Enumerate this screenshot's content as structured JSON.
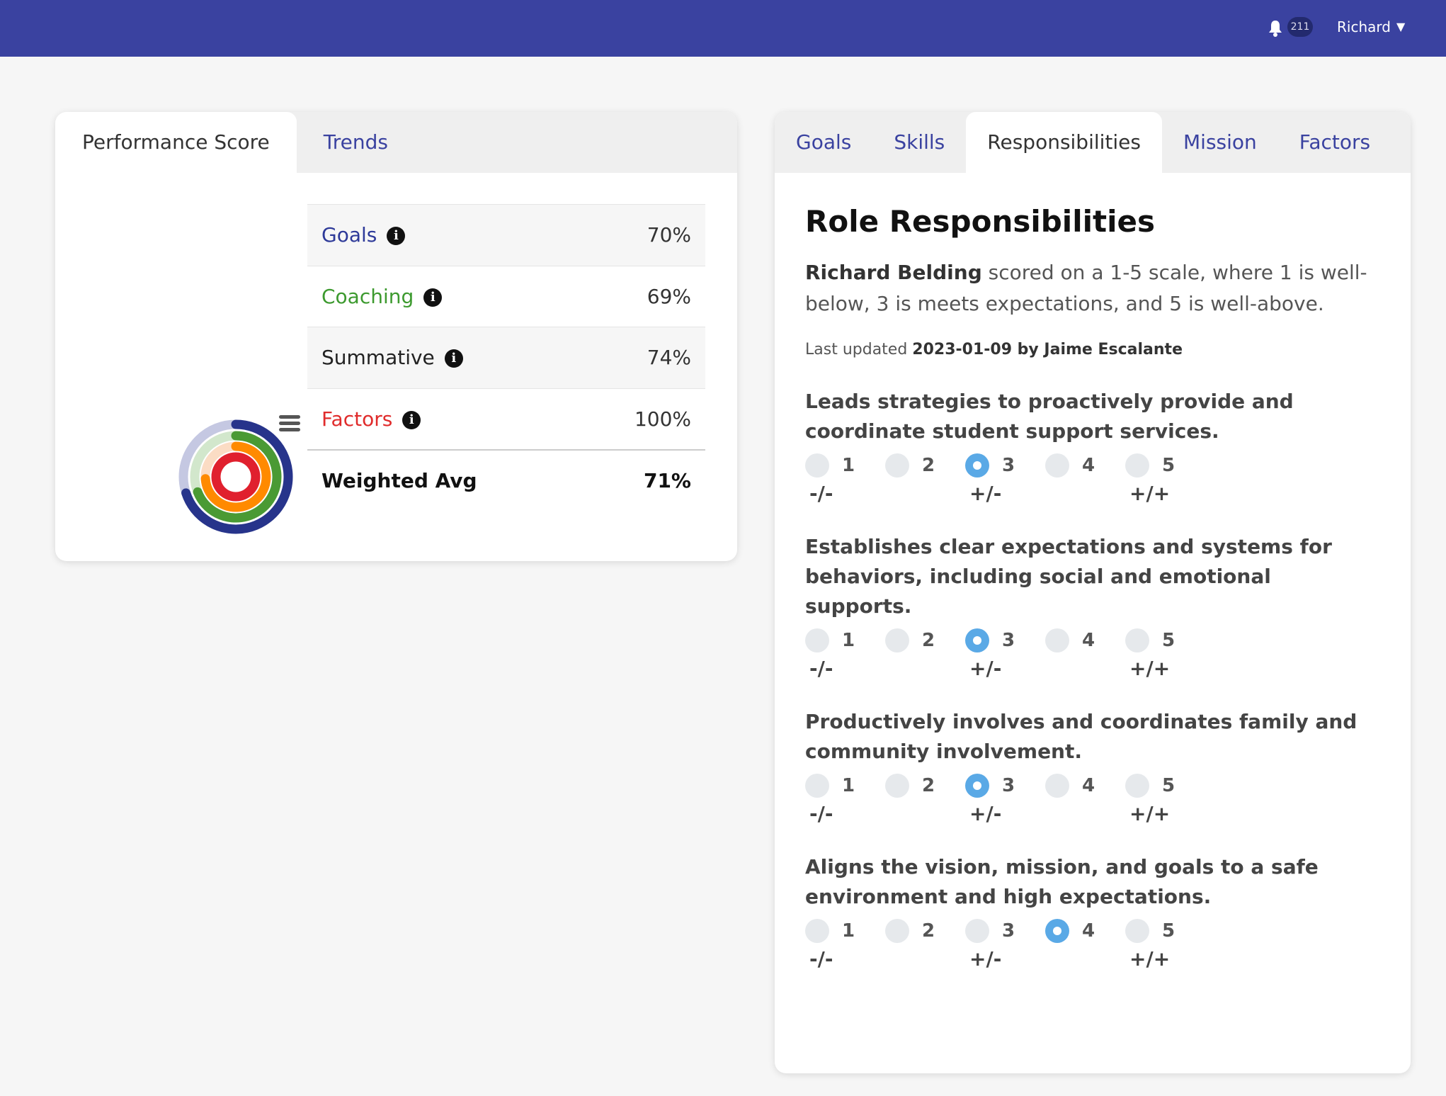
{
  "header": {
    "notification_count": "211",
    "user_name": "Richard",
    "icons": [
      "bell-icon",
      "chevron-down-icon"
    ],
    "color": "#3a42a0"
  },
  "left_panel": {
    "tabs": [
      {
        "label": "Performance Score",
        "active": true
      },
      {
        "label": "Trends",
        "active": false
      }
    ],
    "rows": [
      {
        "label": "Goals",
        "value": "70%",
        "color": "#2e3a99"
      },
      {
        "label": "Coaching",
        "value": "69%",
        "color": "#3d9a2f"
      },
      {
        "label": "Summative",
        "value": "74%",
        "color": "#222222"
      },
      {
        "label": "Factors",
        "value": "100%",
        "color": "#e02b2b"
      }
    ],
    "total": {
      "label": "Weighted Avg",
      "value": "71%"
    }
  },
  "chart_data": {
    "type": "radial-bar",
    "series": [
      {
        "name": "Goals",
        "value": 70,
        "color": "#27348b",
        "track": "#c5c8e2"
      },
      {
        "name": "Coaching",
        "value": 69,
        "color": "#4a9a34",
        "track": "#d2e7cc"
      },
      {
        "name": "Summative",
        "value": 74,
        "color": "#ff8a00",
        "track": "#fbdcc4"
      },
      {
        "name": "Factors",
        "value": 100,
        "color": "#e0202e",
        "track": "#f7c6c9"
      }
    ],
    "max": 100
  },
  "right_panel": {
    "tabs": [
      {
        "label": "Goals",
        "active": false
      },
      {
        "label": "Skills",
        "active": false
      },
      {
        "label": "Responsibilities",
        "active": true
      },
      {
        "label": "Mission",
        "active": false
      },
      {
        "label": "Factors",
        "active": false
      }
    ],
    "title": "Role Responsibilities",
    "intro_name": "Richard Belding",
    "intro_text": " scored on a 1-5 scale, where 1 is well-below, 3 is meets expectations, and 5 is well-above.",
    "updated_prefix": "Last updated ",
    "updated_value": "2023-01-09 by Jaime Escalante",
    "scale_labels": [
      "-/-",
      "+/-",
      "+/+"
    ],
    "options": [
      "1",
      "2",
      "3",
      "4",
      "5"
    ],
    "questions": [
      {
        "text": "Leads strategies to proactively provide and coordinate student support services.",
        "selected": "3"
      },
      {
        "text": "Establishes clear expectations and systems for behaviors, including social and emotional supports.",
        "selected": "3"
      },
      {
        "text": "Productively involves and coordinates family and community involvement.",
        "selected": "3"
      },
      {
        "text": "Aligns the vision, mission, and goals to a safe environment and high expectations.",
        "selected": "4"
      }
    ],
    "accent": "#5aa9e6"
  }
}
